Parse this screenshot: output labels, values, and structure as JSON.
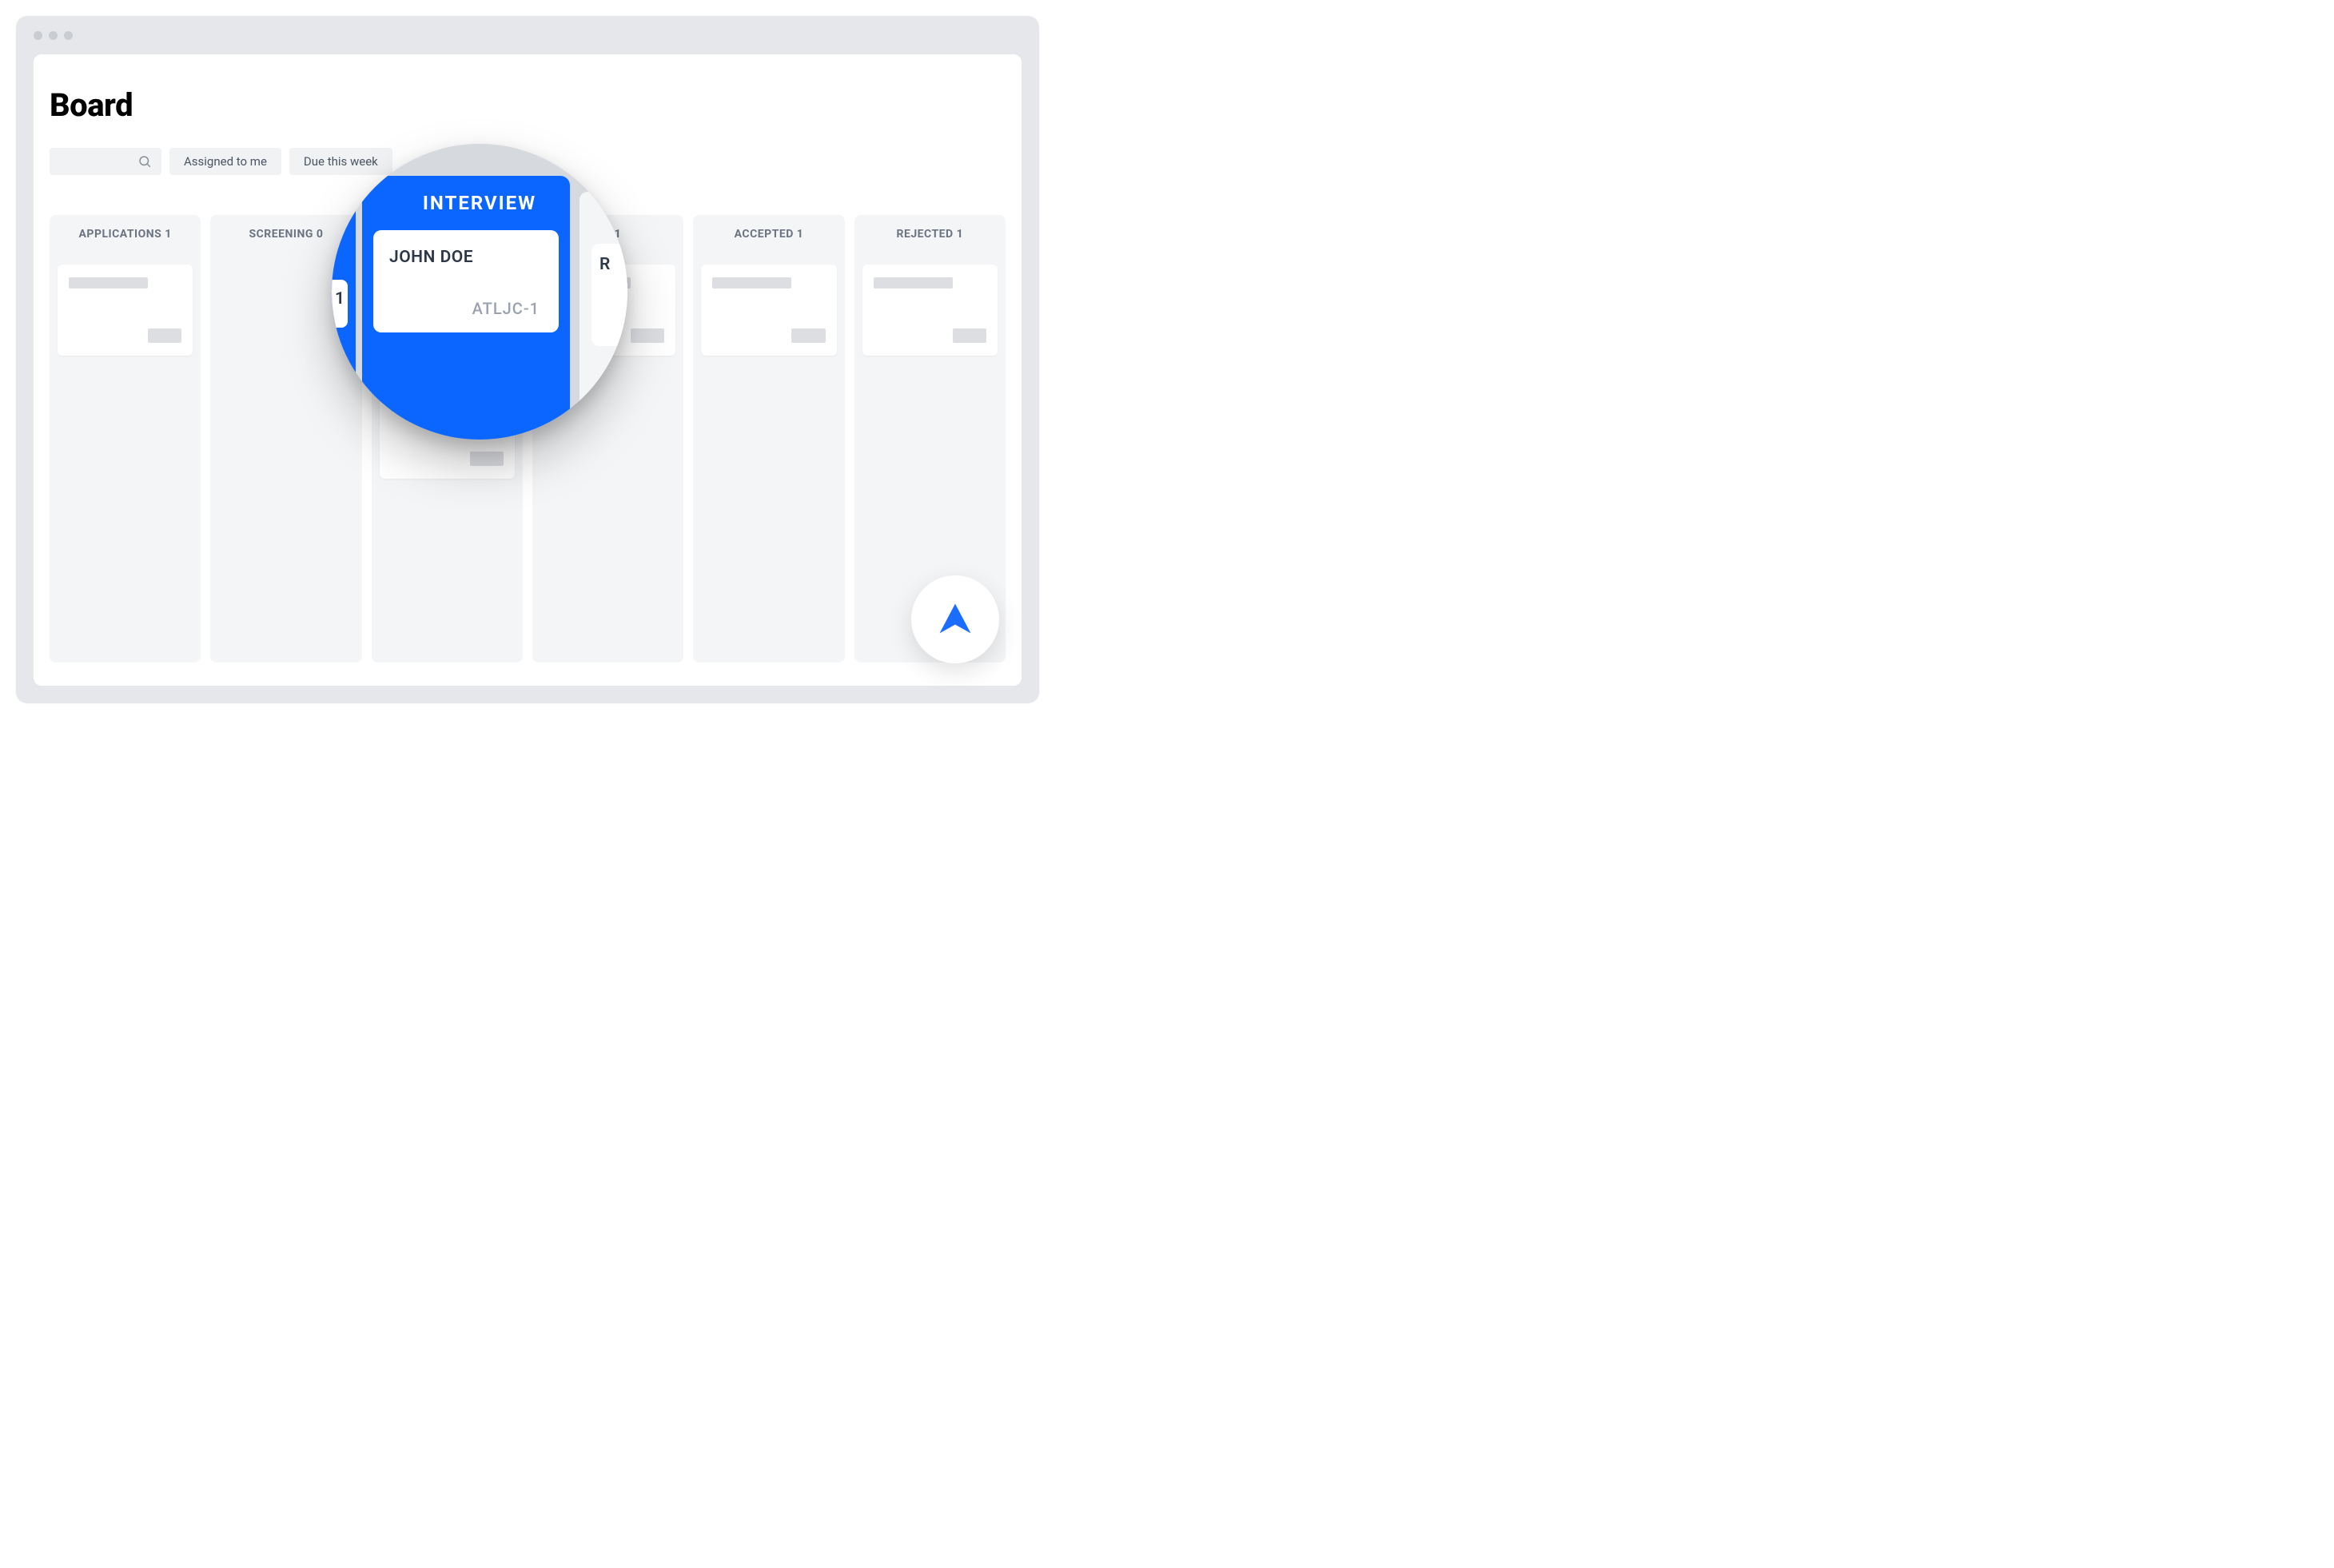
{
  "page": {
    "title": "Board"
  },
  "filters": {
    "assigned": "Assigned to me",
    "due": "Due this week"
  },
  "columns": [
    {
      "label": "APPLICATIONS 1",
      "cards": 1
    },
    {
      "label": "SCREENING 0",
      "cards": 0
    },
    {
      "label": "INTERVIEW",
      "cards": 2
    },
    {
      "label": "ON 1",
      "cards": 1
    },
    {
      "label": "ACCEPTED 1",
      "cards": 1
    },
    {
      "label": "REJECTED 1",
      "cards": 1
    }
  ],
  "magnifier": {
    "column_title": "INTERVIEW",
    "card_name": "JOHN DOE",
    "card_id": "ATLJC-1",
    "right_peek": "R",
    "left_peek": "1"
  },
  "colors": {
    "accent": "#0b66ff",
    "chrome": "#e5e7eb",
    "column_bg": "#f4f5f7",
    "placeholder": "#dcdee2"
  }
}
